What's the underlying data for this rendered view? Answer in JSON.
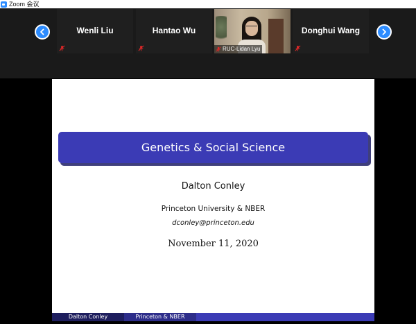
{
  "window": {
    "app_icon": "zoom-app-icon",
    "title": "Zoom 会议"
  },
  "gallery": {
    "prev_icon": "chevron-left-icon",
    "next_icon": "chevron-right-icon",
    "participants": [
      {
        "name": "Wenli Liu",
        "muted": true,
        "video": false
      },
      {
        "name": "Hantao Wu",
        "muted": true,
        "video": false
      },
      {
        "name": "RUC-Lidan Lyu",
        "muted": true,
        "video": true
      },
      {
        "name": "Donghui Wang",
        "muted": true,
        "video": false
      }
    ]
  },
  "slide": {
    "title": "Genetics & Social Science",
    "author": "Dalton Conley",
    "affiliation": "Princeton University & NBER",
    "email": "dconley@princeton.edu",
    "date": "November 11, 2020",
    "footer_left": "Dalton Conley",
    "footer_middle": "Princeton & NBER"
  },
  "colors": {
    "accent": "#2d8cff",
    "slide_title_bg": "#3b3bb5",
    "mute_red": "#e02828"
  }
}
